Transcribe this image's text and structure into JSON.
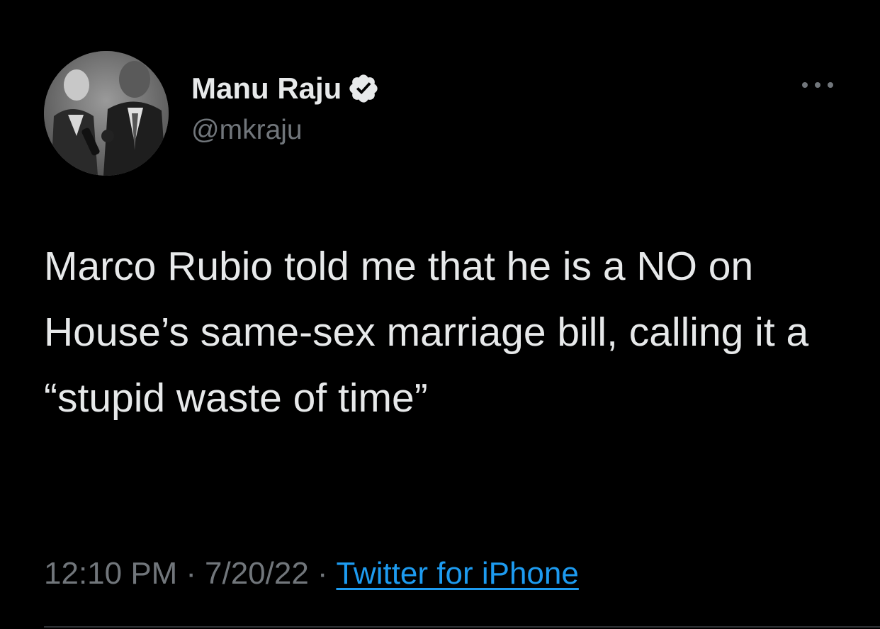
{
  "author": {
    "display_name": "Manu Raju",
    "handle": "@mkraju",
    "verified": true,
    "avatar_icon": "profile-photo-grayscale"
  },
  "tweet": {
    "text": "Marco Rubio told me that he is a NO on House’s same-sex marriage bill, calling it a “stupid waste of time”"
  },
  "meta": {
    "time": "12:10 PM",
    "separator": "·",
    "date": "7/20/22",
    "source": "Twitter for iPhone"
  },
  "icons": {
    "verified_badge": "verified-check-icon",
    "more": "more-dots-icon"
  },
  "colors": {
    "background": "#000000",
    "primary_text": "#e7e9ea",
    "secondary_text": "#71767b",
    "link": "#1d9bf0"
  }
}
